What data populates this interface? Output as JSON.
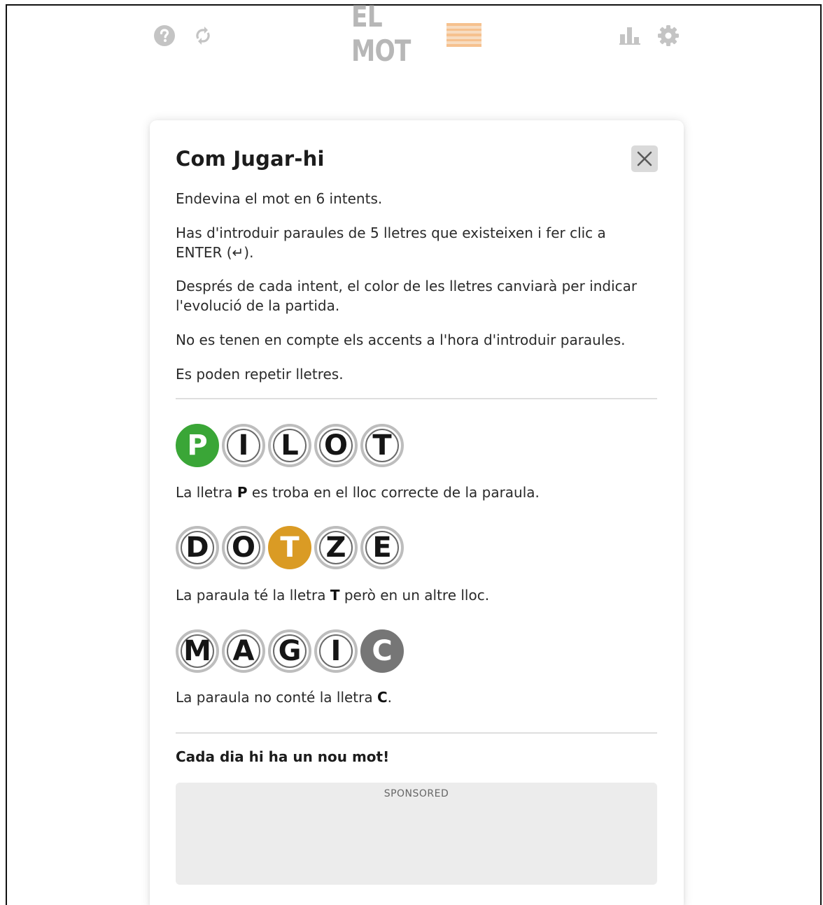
{
  "header": {
    "logo_text": "EL MOT",
    "icons": [
      "help-icon",
      "refresh-icon",
      "stats-icon",
      "settings-icon"
    ]
  },
  "modal": {
    "title": "Com Jugar-hi",
    "intro": [
      "Endevina el mot en 6 intents.",
      "Has d'introduir paraules de 5 lletres que existeixen i fer clic a ENTER (↵).",
      "Després de cada intent, el color de les lletres canviarà per indicar l'evolució de la partida.",
      "No es tenen en compte els accents a l'hora d'introduir paraules.",
      "Es poden repetir lletres."
    ],
    "examples": [
      {
        "letters": [
          "P",
          "I",
          "L",
          "O",
          "T"
        ],
        "highlight_index": 0,
        "state": "correct",
        "desc_before": "La lletra ",
        "desc_letter": "P",
        "desc_after": " es troba en el lloc correcte de la paraula."
      },
      {
        "letters": [
          "D",
          "O",
          "T",
          "Z",
          "E"
        ],
        "highlight_index": 2,
        "state": "present",
        "desc_before": "La paraula té la lletra ",
        "desc_letter": "T",
        "desc_after": " però en un altre lloc."
      },
      {
        "letters": [
          "M",
          "A",
          "G",
          "I",
          "C"
        ],
        "highlight_index": 4,
        "state": "absent",
        "desc_before": "La paraula no conté la lletra ",
        "desc_letter": "C",
        "desc_after": "."
      }
    ],
    "footer": "Cada dia hi ha un nou mot!",
    "ad_label": "SPONSORED"
  },
  "colors": {
    "correct": "#3aa637",
    "present": "#da9b24",
    "absent": "#767676"
  }
}
